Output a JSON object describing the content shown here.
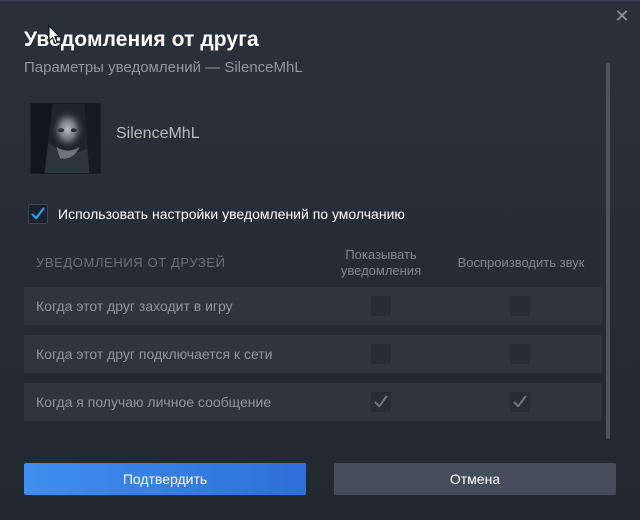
{
  "dialog": {
    "title": "Уведомления от друга",
    "subtitle": "Параметры уведомлений — SilenceMhL",
    "close_icon": "close-icon"
  },
  "friend": {
    "name": "SilenceMhL",
    "avatar_icon": "avatar"
  },
  "default_settings": {
    "label": "Использовать настройки уведомлений по умолчанию",
    "checked": true
  },
  "table": {
    "section_header": "УВЕДОМЛЕНИЯ ОТ ДРУЗЕЙ",
    "col_show": "Показывать уведомления",
    "col_sound": "Воспроизводить звук",
    "rows": [
      {
        "label": "Когда этот друг заходит в игру",
        "show": false,
        "sound": false
      },
      {
        "label": "Когда этот друг подключается к сети",
        "show": false,
        "sound": false
      },
      {
        "label": "Когда я получаю личное сообщение",
        "show": true,
        "sound": true
      }
    ]
  },
  "buttons": {
    "confirm": "Подтвердить",
    "cancel": "Отмена"
  },
  "colors": {
    "accent": "#1a9fff",
    "confirm_start": "#3e8ef0",
    "confirm_end": "#2e6fd8",
    "background": "#242a33"
  }
}
